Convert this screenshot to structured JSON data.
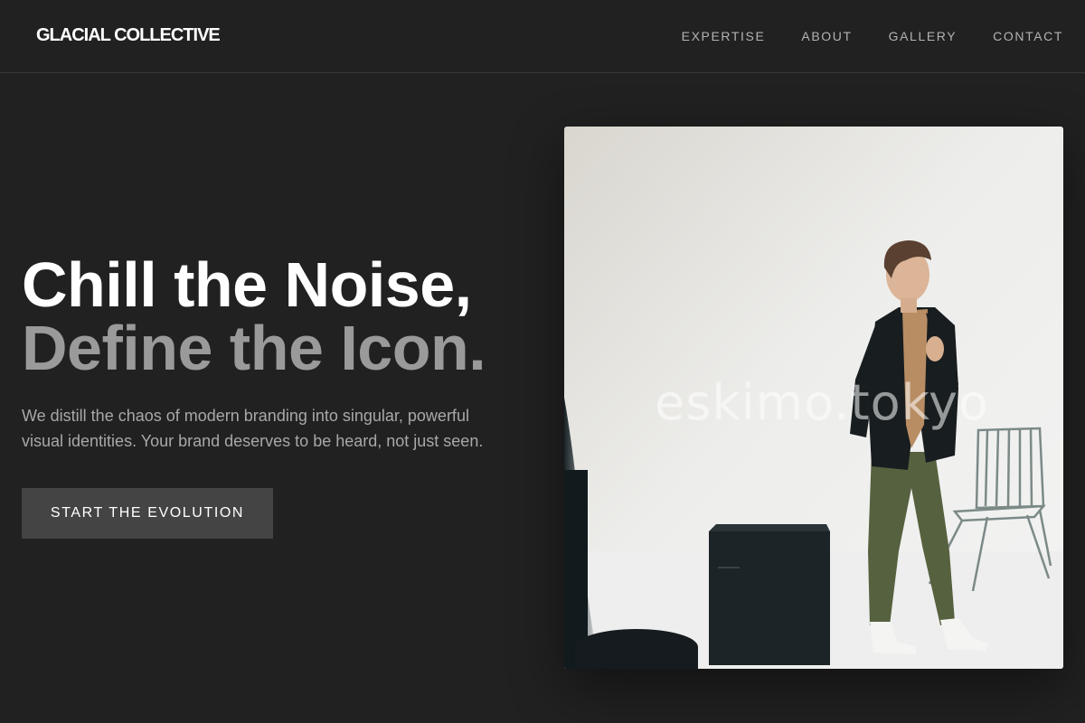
{
  "brand": {
    "name": "GLACIAL COLLECTIVE"
  },
  "nav": {
    "items": [
      {
        "label": "EXPERTISE"
      },
      {
        "label": "ABOUT"
      },
      {
        "label": "GALLERY"
      },
      {
        "label": "CONTACT"
      }
    ]
  },
  "hero": {
    "headline_line1": "Chill the Noise,",
    "headline_line2": "Define the Icon.",
    "description": "We distill the chaos of modern branding into singular, powerful visual identities. Your brand deserves to be heard, not just seen.",
    "cta_label": "START THE EVOLUTION"
  },
  "image": {
    "watermark": "eskimo.tokyo",
    "subject": "man in dark blazer and green trousers beside a black cube and a wire chair"
  },
  "colors": {
    "background": "#212121",
    "heading_primary": "#ffffff",
    "heading_secondary": "#9a9a9a",
    "body_text": "#a8a8a8",
    "button_bg": "#444444"
  }
}
